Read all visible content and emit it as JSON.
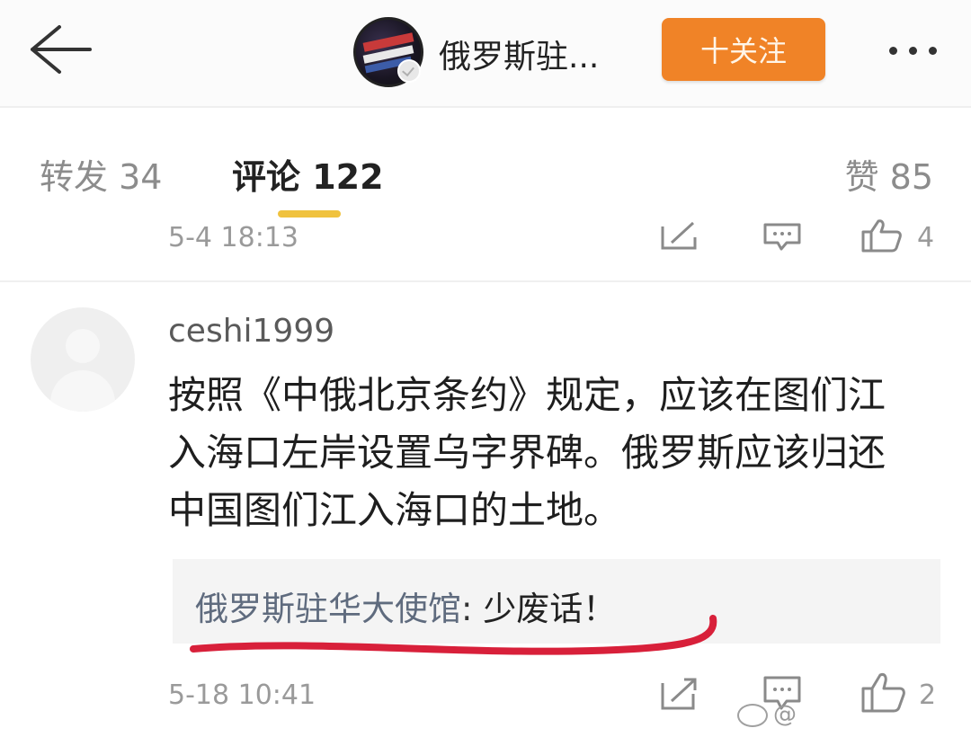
{
  "header": {
    "back_icon": "back-arrow-icon",
    "account_name": "俄罗斯驻...",
    "follow_label": "十关注",
    "more_icon": "more-dots-icon",
    "accent_color": "#f08327"
  },
  "tabs": {
    "repost": "转发 34",
    "comment": "评论 122",
    "like": "赞 85",
    "indicator_color": "#f0c23e"
  },
  "prev_comment": {
    "time": "5-4 18:13",
    "like_count": "4"
  },
  "comment": {
    "username": "ceshi1999",
    "text": "按照《中俄北京条约》规定，应该在图们江入海口左岸设置乌字界碑。俄罗斯应该归还中国图们江入海口的土地。",
    "reply_author": "俄罗斯驻华大使馆",
    "reply_sep": ": ",
    "reply_body": "少废话！",
    "time": "5-18 10:41",
    "like_count": "2",
    "highlight_color": "#d8203a"
  },
  "watermark": {
    "text": "@"
  }
}
